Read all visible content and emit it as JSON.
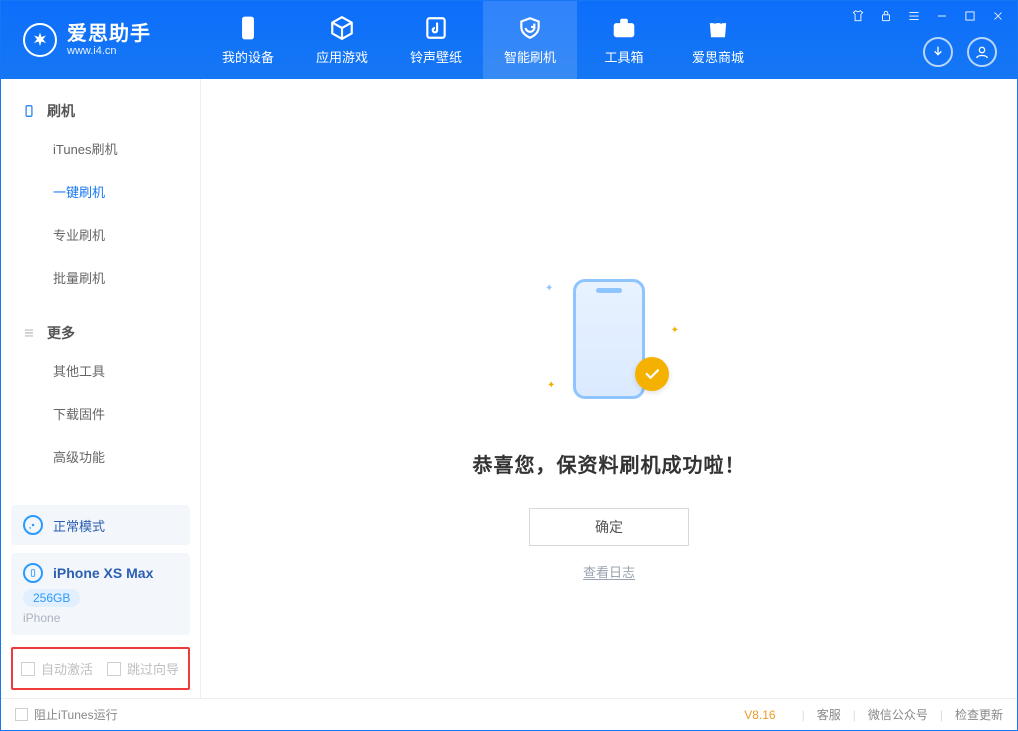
{
  "app": {
    "name_cn": "爱思助手",
    "name_en": "www.i4.cn"
  },
  "nav": {
    "items": [
      {
        "label": "我的设备"
      },
      {
        "label": "应用游戏"
      },
      {
        "label": "铃声壁纸"
      },
      {
        "label": "智能刷机"
      },
      {
        "label": "工具箱"
      },
      {
        "label": "爱思商城"
      }
    ],
    "active_index": 3
  },
  "sidebar": {
    "group1": {
      "title": "刷机"
    },
    "items1": [
      {
        "label": "iTunes刷机"
      },
      {
        "label": "一键刷机"
      },
      {
        "label": "专业刷机"
      },
      {
        "label": "批量刷机"
      }
    ],
    "active1": 1,
    "group2": {
      "title": "更多"
    },
    "items2": [
      {
        "label": "其他工具"
      },
      {
        "label": "下载固件"
      },
      {
        "label": "高级功能"
      }
    ],
    "mode_label": "正常模式",
    "device": {
      "name": "iPhone XS Max",
      "storage": "256GB",
      "type": "iPhone"
    },
    "option_auto_activate": "自动激活",
    "option_skip_guide": "跳过向导"
  },
  "main": {
    "success_title": "恭喜您，保资料刷机成功啦！",
    "ok_label": "确定",
    "log_link": "查看日志"
  },
  "footer": {
    "block_itunes": "阻止iTunes运行",
    "version": "V8.16",
    "support": "客服",
    "wechat": "微信公众号",
    "check_update": "检查更新"
  }
}
